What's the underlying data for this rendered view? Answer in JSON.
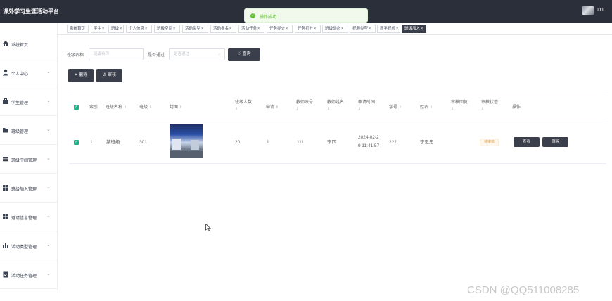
{
  "app": {
    "title": "课外学习生涯活动平台",
    "user_name": "111"
  },
  "toast": {
    "message": "操作成功"
  },
  "sidebar": {
    "items": [
      {
        "label": "系统首页",
        "icon": "home-icon"
      },
      {
        "label": "个人中心",
        "icon": "user-icon"
      },
      {
        "label": "学生管理",
        "icon": "briefcase-icon"
      },
      {
        "label": "班级管理",
        "icon": "folder-icon"
      },
      {
        "label": "班级空间管理",
        "icon": "list-icon"
      },
      {
        "label": "班级加入管理",
        "icon": "grid-icon"
      },
      {
        "label": "邀请信息管理",
        "icon": "grid-icon"
      },
      {
        "label": "活动类型管理",
        "icon": "bar-chart-icon"
      },
      {
        "label": "活动任务管理",
        "icon": "clipboard-check-icon"
      }
    ]
  },
  "tags": [
    {
      "label": "系统首页",
      "closable": false
    },
    {
      "label": "学生",
      "closable": true
    },
    {
      "label": "班级",
      "closable": true
    },
    {
      "label": "个人信息",
      "closable": true
    },
    {
      "label": "班级空间",
      "closable": true
    },
    {
      "label": "活动类型",
      "closable": true
    },
    {
      "label": "活动报名",
      "closable": true
    },
    {
      "label": "活动任务",
      "closable": true
    },
    {
      "label": "任务提交",
      "closable": true
    },
    {
      "label": "任务打分",
      "closable": true
    },
    {
      "label": "班级动态",
      "closable": true
    },
    {
      "label": "视频类型",
      "closable": true
    },
    {
      "label": "教学视频",
      "closable": true
    },
    {
      "label": "班级加入",
      "closable": true,
      "active": true
    }
  ],
  "search": {
    "class_name_label": "班级名称",
    "class_name_placeholder": "班级名称",
    "approved_label": "是否通过",
    "approved_placeholder": "是否通过",
    "query_button": "查询"
  },
  "actions": {
    "delete_button": "删除",
    "review_button": "审核"
  },
  "table": {
    "headers": {
      "index": "索引",
      "class_name": "班级名称",
      "class": "班级",
      "photo": "封面",
      "size": "班级人数",
      "apply": "申请",
      "teacher_account": "教师账号",
      "teacher_name": "教师姓名",
      "apply_time": "申请时间",
      "student_no": "学号",
      "name": "姓名",
      "review_reply": "审核回复",
      "review_status": "审核状态",
      "ops": "操作"
    },
    "rows": [
      {
        "index": "1",
        "class_name": "某班级",
        "class": "301",
        "size": "20",
        "apply": "1",
        "teacher_account": "111",
        "teacher_name": "李四",
        "apply_time_line1": "2024-02-2",
        "apply_time_line2": "9 11:41:57",
        "student_no": "222",
        "name": "李思思",
        "review_reply": "",
        "review_status": "待审核",
        "view_button": "查看",
        "delete_button": "删除"
      }
    ]
  },
  "watermark": "CSDN @QQ511008285",
  "colors": {
    "topbar": "#2b2f3a",
    "accent": "#21b08a",
    "dark_button": "#3a3f4b",
    "success": "#67c23a",
    "warning": "#e6a23c"
  }
}
